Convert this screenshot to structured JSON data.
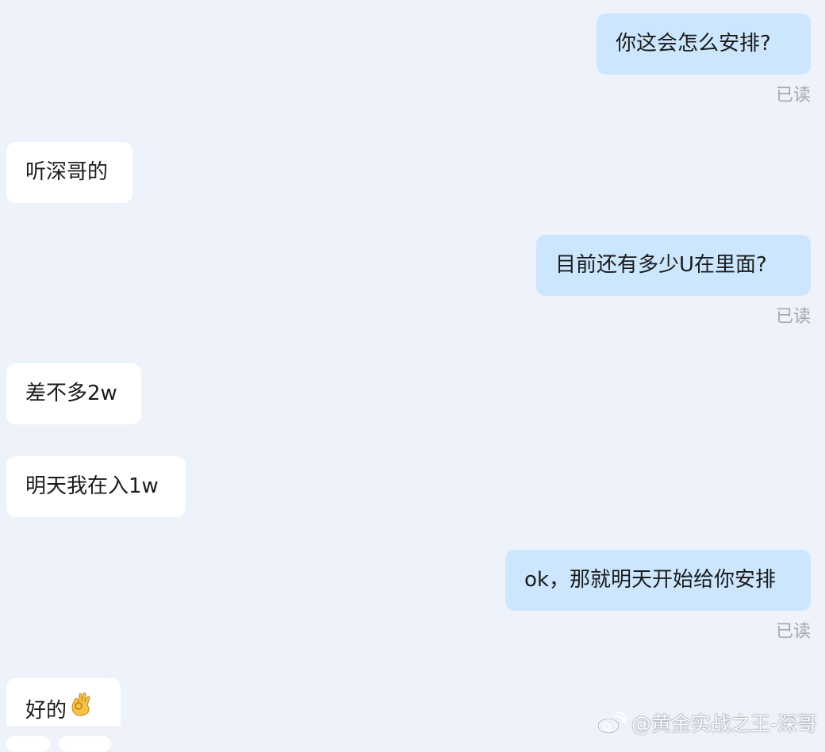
{
  "messages": [
    {
      "side": "sent",
      "text": "你这会怎么安排?",
      "status": "已读"
    },
    {
      "side": "received",
      "text": "听深哥的"
    },
    {
      "side": "sent",
      "text": "目前还有多少U在里面?",
      "status": "已读"
    },
    {
      "side": "received",
      "text": "差不多2w"
    },
    {
      "side": "received",
      "text": "明天我在入1w"
    },
    {
      "side": "sent",
      "text": "ok，那就明天开始给你安排",
      "status": "已读"
    },
    {
      "side": "received",
      "text": "好的",
      "emoji": "ok-hand-emoji"
    }
  ],
  "watermark": {
    "icon": "weibo-icon",
    "text": "@黄金实战之王-深哥"
  },
  "colors": {
    "background": "#eef2fa",
    "sent_bubble": "#cce6fe",
    "received_bubble": "#ffffff",
    "read_status": "#a2a7b0",
    "emoji": "#f6c24a"
  }
}
